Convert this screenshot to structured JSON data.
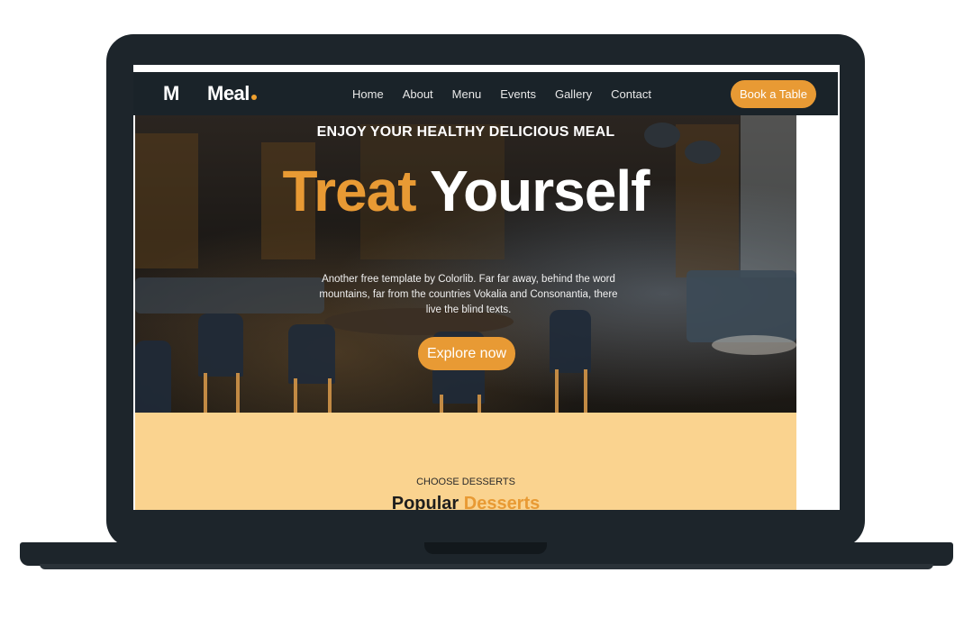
{
  "navbar": {
    "logo_mark": "M",
    "logo_text": "Meal",
    "links": [
      "Home",
      "About",
      "Menu",
      "Events",
      "Gallery",
      "Contact"
    ],
    "cta_label": "Book a Table"
  },
  "hero": {
    "kicker": "ENJOY YOUR HEALTHY DELICIOUS MEAL",
    "title_accent": "Treat",
    "title_rest": "Yourself",
    "description": "Another free template by Colorlib. Far far away, behind the word mountains, far from the countries Vokalia and Consonantia, there live the blind texts.",
    "button_label": "Explore now"
  },
  "desserts": {
    "kicker": "CHOOSE DESSERTS",
    "title_main": "Popular",
    "title_accent": "Desserts"
  },
  "colors": {
    "accent": "#e89a34",
    "navbar_bg": "#1a2329",
    "section_bg": "#fad38f",
    "laptop": "#1d252b"
  }
}
